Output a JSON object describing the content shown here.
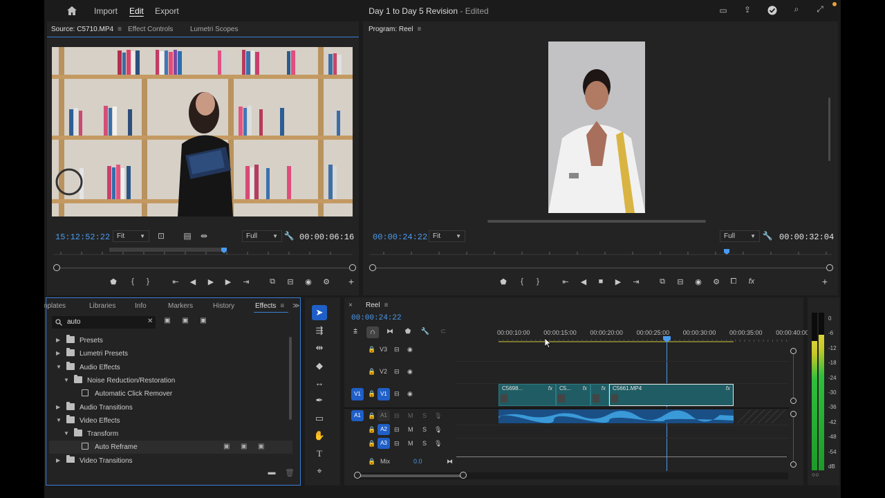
{
  "menu": {
    "import": "Import",
    "edit": "Edit",
    "export": "Export"
  },
  "project": {
    "title": "Day 1 to Day 5 Revision",
    "status": "- Edited"
  },
  "source": {
    "tabs": [
      "Source: C5710.MP4",
      "Effect Controls",
      "Lumetri Scopes"
    ],
    "menu_glyph": "≡",
    "timecode": "15:12:52:22",
    "fit": "Fit",
    "quality": "Full",
    "duration": "00:00:06:16"
  },
  "program": {
    "tab": "Program: Reel",
    "menu_glyph": "≡",
    "timecode": "00:00:24:22",
    "fit": "Fit",
    "quality": "Full",
    "duration": "00:00:32:04"
  },
  "effects_panel": {
    "tabs": [
      "mplates",
      "Libraries",
      "Info",
      "Markers",
      "History",
      "Effects"
    ],
    "menu_glyph": "≡",
    "search_value": "auto",
    "overflow_glyph": "≫",
    "clear_glyph": "✕",
    "tree": [
      {
        "label": "Presets",
        "indent": 0,
        "open": false,
        "kind": "folder"
      },
      {
        "label": "Lumetri Presets",
        "indent": 0,
        "open": false,
        "kind": "folder"
      },
      {
        "label": "Audio Effects",
        "indent": 0,
        "open": true,
        "kind": "folder"
      },
      {
        "label": "Noise Reduction/Restoration",
        "indent": 1,
        "open": true,
        "kind": "folder"
      },
      {
        "label": "Automatic Click Remover",
        "indent": 2,
        "open": false,
        "kind": "effect"
      },
      {
        "label": "Audio Transitions",
        "indent": 0,
        "open": false,
        "kind": "folder"
      },
      {
        "label": "Video Effects",
        "indent": 0,
        "open": true,
        "kind": "folder"
      },
      {
        "label": "Transform",
        "indent": 1,
        "open": true,
        "kind": "folder"
      },
      {
        "label": "Auto Reframe",
        "indent": 2,
        "open": false,
        "kind": "effect"
      },
      {
        "label": "Video Transitions",
        "indent": 0,
        "open": false,
        "kind": "folder"
      }
    ]
  },
  "timeline": {
    "close_glyph": "×",
    "tab": "Reel",
    "menu_glyph": "≡",
    "timecode": "00:00:24:22",
    "ruler": [
      "00:00:10:00",
      "00:00:15:00",
      "00:00:20:00",
      "00:00:25:00",
      "00:00:30:00",
      "00:00:35:00",
      "00:00:40:00"
    ],
    "tracks_video": [
      "V3",
      "V2",
      "V1"
    ],
    "tracks_audio": [
      "A1",
      "A2",
      "A3"
    ],
    "source_patch_v": "V1",
    "source_patch_a": "A1",
    "mute_label": "M",
    "solo_label": "S",
    "mix_label": "Mix",
    "mix_value": "0.0",
    "clips": [
      {
        "name": "C5698...",
        "fx": "fx"
      },
      {
        "name": "C5...",
        "fx": "fx"
      },
      {
        "name": "",
        "fx": "fx"
      },
      {
        "name": "C5661.MP4",
        "fx": "fx"
      }
    ]
  },
  "meter": {
    "labels": [
      "0",
      "-6",
      "-12",
      "-18",
      "-24",
      "-30",
      "-36",
      "-42",
      "-48",
      "-54",
      "dB"
    ],
    "level_left": 0.82,
    "level_right": 0.86
  },
  "colors": {
    "accent": "#4a9bf0",
    "clip": "#1f5c63",
    "audio_wave": "#2f8fd0",
    "track_badge": "#1f5fc7"
  }
}
